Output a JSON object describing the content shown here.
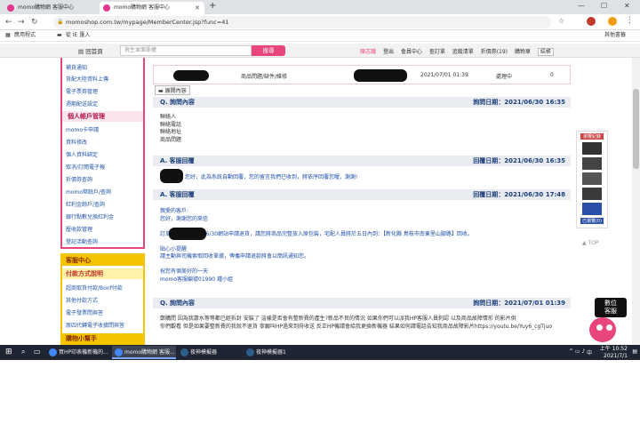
{
  "browser": {
    "tabs": [
      {
        "label": "momo購物網 客服中心",
        "active": false
      },
      {
        "label": "momo購物網 客服中心",
        "active": true
      }
    ],
    "new_tab": "+",
    "url": "momoshop.com.tw/mypage/MemberCenter.jsp?func=41",
    "bookmarks": [
      "應用程式",
      "從 IE 匯入"
    ],
    "other_bookmarks": "其他書籤"
  },
  "site": {
    "home": "回首頁",
    "search_placeholder": "貿生並面罪權",
    "search_button": "搜尋",
    "toplinks": {
      "user": "陳志鐵",
      "logout": "登出",
      "member_center": "會員中心",
      "orders": "查訂單",
      "tracking": "追蹤清單",
      "coupons": "折價券(19)",
      "cart": "購物車",
      "checkout": "結帳"
    }
  },
  "sidebar": {
    "items_top": [
      "補貨通知",
      "貨配大陸資料上傳",
      "電子票券管理",
      "週期配送設定"
    ],
    "section_account": "個人帳戶管理",
    "items_account": [
      "momo卡申請",
      "資料修改",
      "個人資料綁定",
      "取消/訂閱電子報",
      "折價券查詢",
      "momo幣餘戶/查詢",
      "紅利金餘戶/查詢",
      "銀行點數兌換紅利金",
      "壓收款管理",
      "登記活動查詢"
    ],
    "section_service": "客服中心",
    "section_payment": "付款方式說明",
    "items_payment": [
      "超商取貨付款/Bonf付款",
      "其他付款方式",
      "電子發票問與答",
      "原四代轉電子收據問與答"
    ],
    "section_guide": "購物小幫手"
  },
  "main": {
    "table": {
      "category": "商品問題/缺件/維修",
      "datetime": "2021/07/01 01:39",
      "status": "處理中",
      "count": "0"
    },
    "expand_button": "展開內容",
    "blocks": [
      {
        "type": "Q",
        "title": "詢問內容",
        "date_label": "詢問日期：2021/06/30 16:35",
        "lines": [
          "聯絡人",
          "聯絡電話",
          "聯絡地址",
          "商品問題"
        ]
      },
      {
        "type": "A",
        "title": "客服回覆",
        "date_label": "回覆日期：2021/06/30 16:35",
        "lines": [
          "您好，此為系統自動回覆，您的留言我們已收到，將依序回覆您喔，謝謝!"
        ]
      },
      {
        "type": "A",
        "title": "客服回覆",
        "date_label": "回覆日期：2021/06/30 17:48",
        "lines": [
          "親愛的客戶:",
          "您好，謝謝您的來信",
          "",
          "訂單                    64查詢您已於6/30網站申請退貨，請您將商品完整放入原包裝，宅配人員將於五日內到：【新化縣 鳥枝市南東里山腳路】回收。",
          "",
          "貼心小提醒",
          "請主動與司機索取回收單據，俾攜申請退款將會以簡訊通知您。",
          "",
          "祝您有個美好的一天",
          "momo客服編號01990 鍾小姐"
        ]
      },
      {
        "type": "Q",
        "title": "詢問內容",
        "date_label": "詢問日期：2021/07/01 01:39",
        "lines": [
          "鄭購問 因為我蕭水等等都已經拆封 安裝了 這樣是否會有整新費的產生?新品不良的情況 如果你們可以派我HP客服人員刺認 以及商品故障情形 的影片供",
          "你們觀看 但是如果要整新費的我就不退貨 寧願叫HP過來到府收送 反正HP機請會給我更換新機器 結果如何請電話告知我商品故障影片https://youtu.be/Yuy6_cgTjuo"
        ]
      }
    ]
  },
  "right": {
    "ad_label": "瀏覽紀錄",
    "ad_footer": "已瀏覽(0)",
    "top": "TOP",
    "mascot_text": [
      "數位",
      "客服"
    ]
  },
  "taskbar": {
    "items": [
      {
        "label": "買HP印表機新機的...",
        "active": false
      },
      {
        "label": "momo購物網 客服...",
        "active": true
      },
      {
        "label": "夜神模擬器",
        "active": false
      },
      {
        "label": "夜神模擬器1",
        "active": false
      }
    ],
    "ime": "中",
    "time": "上午 10:52",
    "date": "2021/7/1"
  }
}
